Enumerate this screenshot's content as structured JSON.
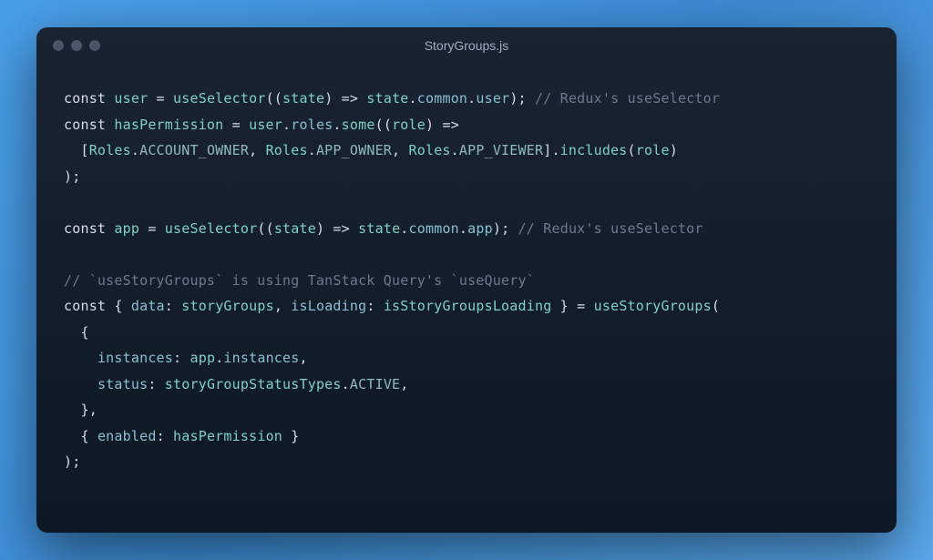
{
  "title": "StoryGroups.js",
  "code": {
    "l1": {
      "kw1": "const",
      "id1": "user",
      "eq": " = ",
      "fn": "useSelector",
      "po": "((",
      "arg": "state",
      "pc": ")",
      "arr": " => ",
      "st": "state",
      "d1": ".",
      "p1": "common",
      "d2": ".",
      "p2": "user",
      "end": ");",
      "cm": " // Redux's useSelector"
    },
    "l2": {
      "kw1": "const",
      "id1": "hasPermission",
      "eq": " = ",
      "u": "user",
      "d1": ".",
      "p1": "roles",
      "d2": ".",
      "fn": "some",
      "po": "((",
      "arg": "role",
      "pc": ")",
      "arr": " =>"
    },
    "l3": {
      "ind": "  ",
      "br": "[",
      "r1": "Roles",
      "d1": ".",
      "c1": "ACCOUNT_OWNER",
      "cm1": ", ",
      "r2": "Roles",
      "d2": ".",
      "c2": "APP_OWNER",
      "cm2": ", ",
      "r3": "Roles",
      "d3": ".",
      "c3": "APP_VIEWER",
      "bc": "]",
      "d4": ".",
      "fn": "includes",
      "po": "(",
      "arg": "role",
      "pc": ")"
    },
    "l4": {
      "t": ");"
    },
    "l5": {
      "t": ""
    },
    "l6": {
      "kw1": "const",
      "id1": "app",
      "eq": " = ",
      "fn": "useSelector",
      "po": "((",
      "arg": "state",
      "pc": ")",
      "arr": " => ",
      "st": "state",
      "d1": ".",
      "p1": "common",
      "d2": ".",
      "p2": "app",
      "end": ");",
      "cm": " // Redux's useSelector"
    },
    "l7": {
      "t": ""
    },
    "l8": {
      "t": "// `useStoryGroups` is using TanStack Query's `useQuery`"
    },
    "l9": {
      "kw1": "const",
      "ob": " { ",
      "k1": "data",
      "c1": ": ",
      "v1": "storyGroups",
      "cm1": ", ",
      "k2": "isLoading",
      "c2": ": ",
      "v2": "isStoryGroupsLoading",
      "cb": " } ",
      "eq": "= ",
      "fn": "useStoryGroups",
      "po": "("
    },
    "l10": {
      "ind": "  ",
      "t": "{"
    },
    "l11": {
      "ind": "    ",
      "k": "instances",
      "c": ": ",
      "o": "app",
      "d": ".",
      "p": "instances",
      "cm": ","
    },
    "l12": {
      "ind": "    ",
      "k": "status",
      "c": ": ",
      "o": "storyGroupStatusTypes",
      "d": ".",
      "p": "ACTIVE",
      "cm": ","
    },
    "l13": {
      "ind": "  ",
      "t": "},"
    },
    "l14": {
      "ind": "  ",
      "ob": "{ ",
      "k": "enabled",
      "c": ": ",
      "v": "hasPermission",
      "cb": " }"
    },
    "l15": {
      "t": ");"
    }
  }
}
